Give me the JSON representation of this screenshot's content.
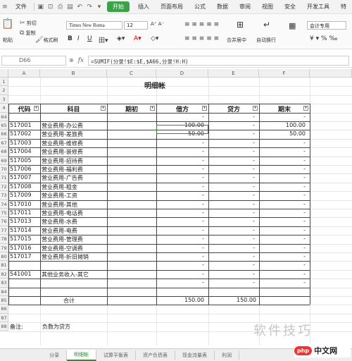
{
  "menubar": {
    "items": [
      "文件",
      "开始",
      "插入",
      "页面布局",
      "公式",
      "数据",
      "审阅",
      "视图",
      "安全",
      "开发工具",
      "特"
    ],
    "active": "开始"
  },
  "ribbon": {
    "paste": "粘贴",
    "cut": "剪切",
    "copy": "复制",
    "format_painter": "格式刷",
    "font_name": "Times New Roma",
    "font_size": "12",
    "merge_center": "合并居中",
    "wrap": "自动换行",
    "number_format": "会计专用"
  },
  "formula_bar": {
    "name_box": "D66",
    "fx": "fx",
    "formula": "=SUMIF(分录!$E:$E,$A66,分录!H:H)"
  },
  "columns": [
    "A",
    "B",
    "C",
    "D",
    "E",
    "F"
  ],
  "sheet": {
    "title": "明细帐",
    "headers": [
      "代码",
      "科目",
      "期初",
      "借方",
      "贷方",
      "期末"
    ],
    "rows": [
      {
        "row": "64",
        "code": "517001",
        "subject": "营业费用-办公费",
        "debit": "100.00",
        "credit": "-",
        "end": "100.00"
      },
      {
        "row": "65",
        "code": "517002",
        "subject": "营业费用-差旅费",
        "debit": "50.00",
        "credit": "-",
        "end": "50.00"
      },
      {
        "row": "66",
        "code": "517003",
        "subject": "营业费用-维修费",
        "debit": "-",
        "credit": "-",
        "end": "-"
      },
      {
        "row": "67",
        "code": "517004",
        "subject": "营业费用-装修费",
        "debit": "-",
        "credit": "-",
        "end": "-"
      },
      {
        "row": "68",
        "code": "517005",
        "subject": "营业费用-招待费",
        "debit": "-",
        "credit": "-",
        "end": "-"
      },
      {
        "row": "69",
        "code": "517006",
        "subject": "营业费用-福利费",
        "debit": "-",
        "credit": "-",
        "end": "-"
      },
      {
        "row": "70",
        "code": "517007",
        "subject": "营业费用-广告费",
        "debit": "-",
        "credit": "-",
        "end": "-"
      },
      {
        "row": "71",
        "code": "517008",
        "subject": "营业费用-租金",
        "debit": "-",
        "credit": "-",
        "end": "-"
      },
      {
        "row": "72",
        "code": "517009",
        "subject": "营业费用-工资",
        "debit": "-",
        "credit": "-",
        "end": "-"
      },
      {
        "row": "73",
        "code": "517010",
        "subject": "营业费用-其他",
        "debit": "-",
        "credit": "-",
        "end": "-"
      },
      {
        "row": "74",
        "code": "517011",
        "subject": "营业费用-电话费",
        "debit": "-",
        "credit": "-",
        "end": "-"
      },
      {
        "row": "75",
        "code": "517013",
        "subject": "营业费用-水费",
        "debit": "-",
        "credit": "-",
        "end": "-"
      },
      {
        "row": "76",
        "code": "517014",
        "subject": "营业费用-电费",
        "debit": "-",
        "credit": "-",
        "end": "-"
      },
      {
        "row": "77",
        "code": "517015",
        "subject": "营业费用-管理费",
        "debit": "-",
        "credit": "-",
        "end": "-"
      },
      {
        "row": "78",
        "code": "517016",
        "subject": "营业费用-空调费",
        "debit": "-",
        "credit": "-",
        "end": "-"
      },
      {
        "row": "79",
        "code": "517017",
        "subject": "营业费用-折旧摊销",
        "debit": "-",
        "credit": "-",
        "end": "-"
      },
      {
        "row": "80",
        "code": "",
        "subject": "",
        "debit": "-",
        "credit": "-",
        "end": "-"
      },
      {
        "row": "81",
        "code": "541001",
        "subject": "其他业务收入-其它",
        "debit": "-",
        "credit": "-",
        "end": "-"
      },
      {
        "row": "82",
        "code": "",
        "subject": "",
        "debit": "-",
        "credit": "-",
        "end": "-"
      }
    ],
    "total_label": "合计",
    "total_debit": "150.00",
    "total_credit": "150.00",
    "note_label": "备注:",
    "note_text": "负数为贷方"
  },
  "top_row_nums": [
    "1",
    "2",
    "3",
    "4"
  ],
  "bottom_row_nums": [
    "85",
    "86",
    "87",
    "88"
  ],
  "sheet_tabs": [
    "分录",
    "明细帐",
    "试算平衡表",
    "资产负债表",
    "现金流量表",
    "利润"
  ],
  "active_tab": "明细帐",
  "watermark": "软件技巧",
  "logo": {
    "badge": "php",
    "text": "中文网"
  }
}
